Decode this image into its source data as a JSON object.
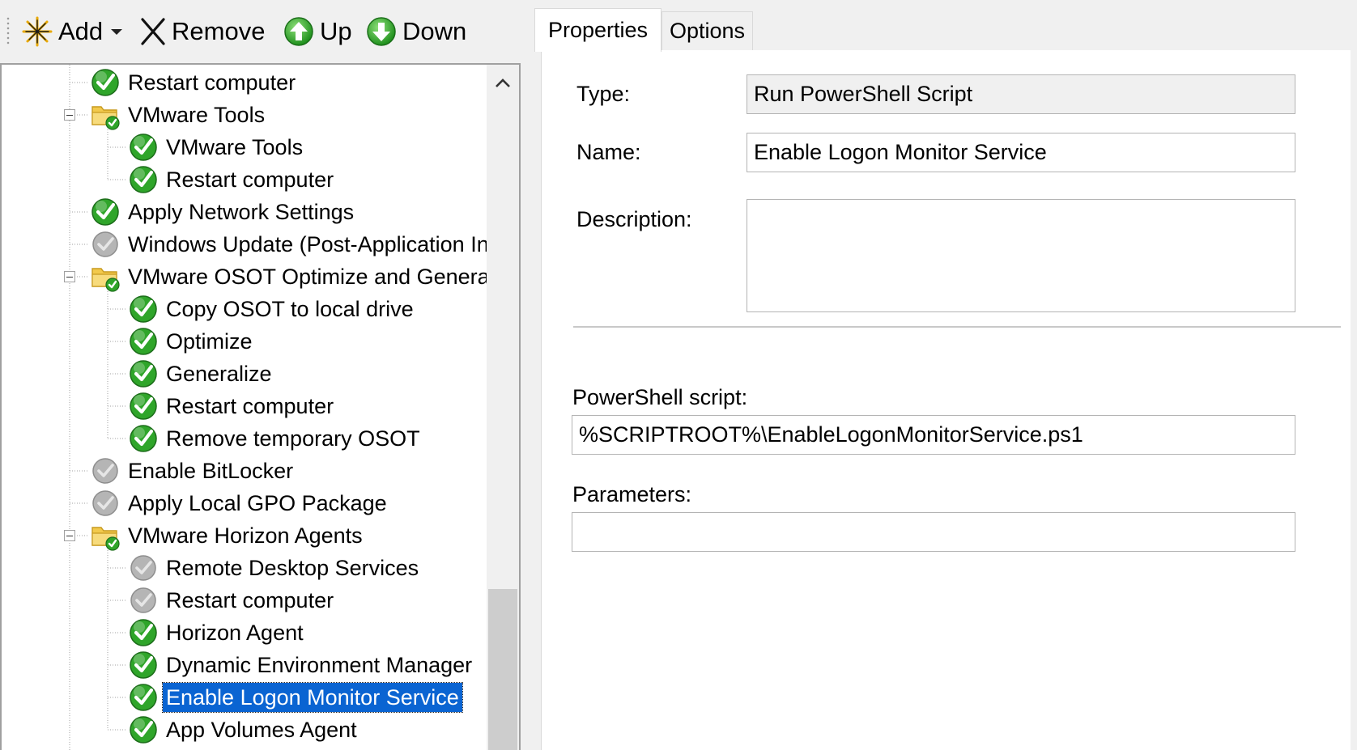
{
  "toolbar": {
    "add_label": "Add",
    "remove_label": "Remove",
    "up_label": "Up",
    "down_label": "Down"
  },
  "tree": {
    "items": [
      {
        "label": "Restart computer",
        "status": "success",
        "level": 1
      },
      {
        "label": "VMware Tools",
        "status": "group",
        "level": 1
      },
      {
        "label": "VMware Tools",
        "status": "success",
        "level": 2
      },
      {
        "label": "Restart computer",
        "status": "success",
        "level": 2
      },
      {
        "label": "Apply Network Settings",
        "status": "success",
        "level": 1
      },
      {
        "label": "Windows Update (Post-Application In",
        "status": "disabled",
        "level": 1
      },
      {
        "label": "VMware OSOT Optimize and Genera",
        "status": "group",
        "level": 1
      },
      {
        "label": "Copy OSOT to local drive",
        "status": "success",
        "level": 2
      },
      {
        "label": "Optimize",
        "status": "success",
        "level": 2
      },
      {
        "label": "Generalize",
        "status": "success",
        "level": 2
      },
      {
        "label": "Restart computer",
        "status": "success",
        "level": 2
      },
      {
        "label": "Remove temporary OSOT",
        "status": "success",
        "level": 2
      },
      {
        "label": "Enable BitLocker",
        "status": "disabled",
        "level": 1
      },
      {
        "label": "Apply Local GPO Package",
        "status": "disabled",
        "level": 1
      },
      {
        "label": "VMware Horizon Agents",
        "status": "group",
        "level": 1
      },
      {
        "label": "Remote Desktop Services",
        "status": "disabled",
        "level": 2
      },
      {
        "label": "Restart computer",
        "status": "disabled",
        "level": 2
      },
      {
        "label": "Horizon Agent",
        "status": "success",
        "level": 2
      },
      {
        "label": "Dynamic Environment Manager",
        "status": "success",
        "level": 2
      },
      {
        "label": "Enable Logon Monitor Service",
        "status": "success",
        "level": 2,
        "selected": true
      },
      {
        "label": "App Volumes Agent",
        "status": "success",
        "level": 2
      }
    ]
  },
  "tabs": {
    "properties": "Properties",
    "options": "Options"
  },
  "form": {
    "type_label": "Type:",
    "type_value": "Run PowerShell Script",
    "name_label": "Name:",
    "name_value": "Enable Logon Monitor Service",
    "description_label": "Description:",
    "description_value": "",
    "script_label": "PowerShell script:",
    "script_value": "%SCRIPTROOT%\\EnableLogonMonitorService.ps1",
    "parameters_label": "Parameters:",
    "parameters_value": ""
  },
  "colors": {
    "selection": "#0a64d2",
    "check_green": "#2fa52a",
    "disabled_gray": "#a8a8a8",
    "folder_yellow": "#f2c94c"
  }
}
